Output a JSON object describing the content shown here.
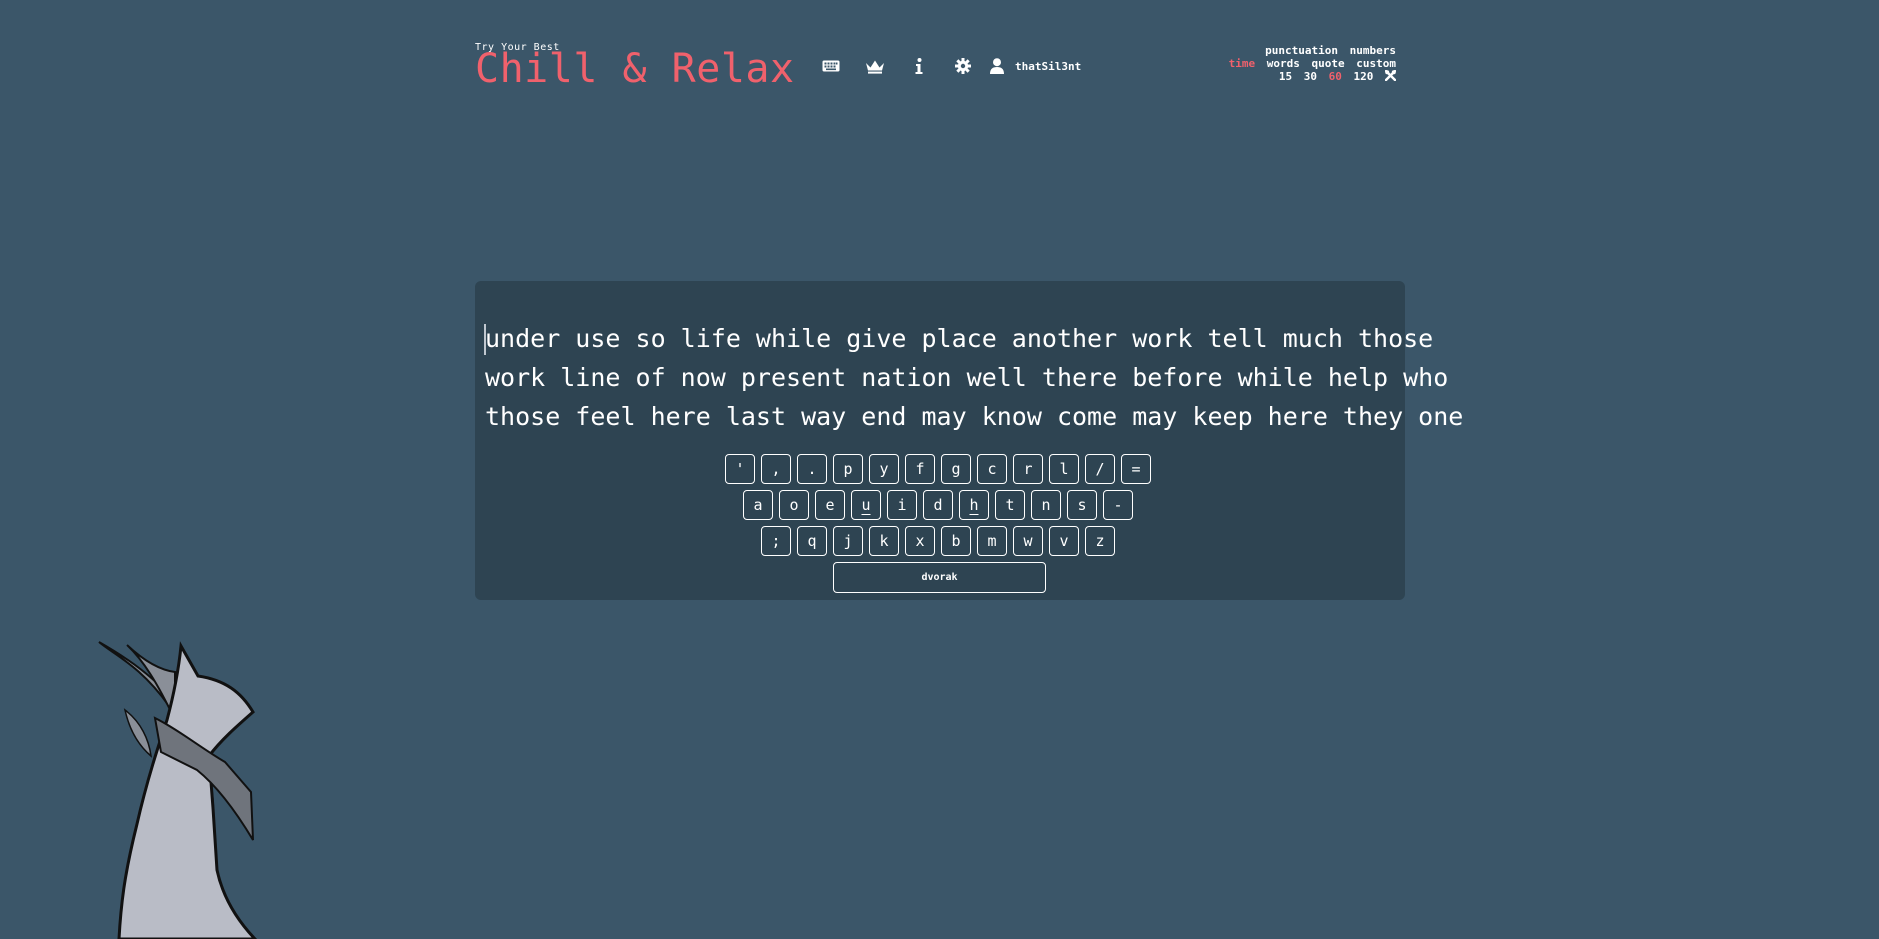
{
  "header": {
    "tagline": "Try Your Best",
    "logo": "Chill & Relax",
    "nav": [
      {
        "icon": "keyboard-icon"
      },
      {
        "icon": "crown-icon"
      },
      {
        "icon": "info-icon"
      },
      {
        "icon": "gear-icon"
      }
    ],
    "account": {
      "icon": "user-icon",
      "name": "thatSil3nt"
    }
  },
  "config": {
    "toggles": [
      "punctuation",
      "numbers"
    ],
    "modes": [
      "time",
      "words",
      "quote",
      "custom"
    ],
    "active_mode": "time",
    "durations": [
      "15",
      "30",
      "60",
      "120"
    ],
    "active_duration": "60",
    "custom_icon": "wrench-icon"
  },
  "test": {
    "lines": [
      "under use so life while give place another work tell much those",
      "work line of now present nation well there before while help who",
      "those feel here last way end may know come may keep here they one"
    ]
  },
  "keyboard": {
    "rows": [
      [
        "'",
        ",",
        ".",
        "p",
        "y",
        "f",
        "g",
        "c",
        "r",
        "l",
        "/",
        "="
      ],
      [
        "a",
        "o",
        "e",
        "u",
        "i",
        "d",
        "h",
        "t",
        "n",
        "s",
        "-"
      ],
      [
        ";",
        "q",
        "j",
        "k",
        "x",
        "b",
        "m",
        "w",
        "v",
        "z"
      ]
    ],
    "home_keys": [
      "u",
      "h"
    ],
    "space_label": "dvorak"
  },
  "colors": {
    "background": "#3b5669",
    "panel": "#2e4452",
    "accent": "#f0616c",
    "text": "#ffffff"
  }
}
